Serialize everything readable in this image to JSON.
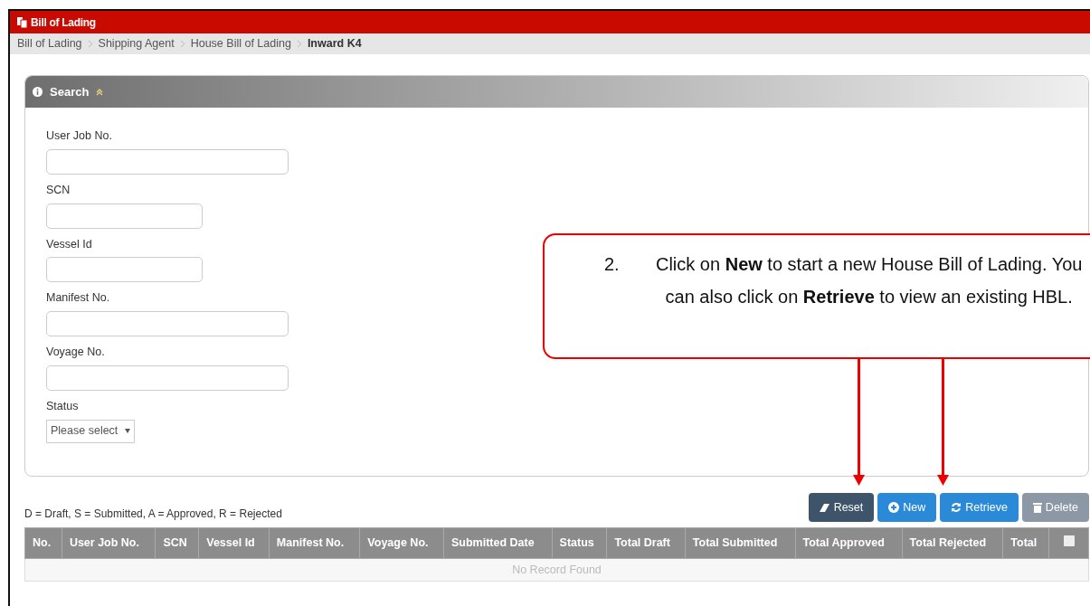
{
  "window": {
    "title": "Bill of Lading"
  },
  "breadcrumb": [
    {
      "label": "Bill of Lading",
      "current": false
    },
    {
      "label": "Shipping Agent",
      "current": false
    },
    {
      "label": "House Bill of Lading",
      "current": false
    },
    {
      "label": "Inward K4",
      "current": true
    }
  ],
  "search_panel": {
    "title": "Search",
    "expanded": true,
    "fields": [
      {
        "label": "User Job No.",
        "kind": "text"
      },
      {
        "label": "SCN",
        "kind": "text"
      },
      {
        "label": "Vessel Id",
        "kind": "text"
      },
      {
        "label": "Manifest No.",
        "kind": "text"
      },
      {
        "label": "Voyage No.",
        "kind": "text"
      },
      {
        "label": "Status",
        "kind": "select",
        "value": "Please select"
      }
    ]
  },
  "legend": "D = Draft, S = Submitted, A = Approved, R = Rejected",
  "buttons": [
    {
      "label": "Reset",
      "kind": "reset",
      "disabled": false
    },
    {
      "label": "New",
      "kind": "new",
      "disabled": false
    },
    {
      "label": "Retrieve",
      "kind": "retrieve",
      "disabled": false
    },
    {
      "label": "Delete",
      "kind": "delete",
      "disabled": true
    }
  ],
  "table": {
    "columns": [
      "No.",
      "User Job No.",
      "SCN",
      "Vessel Id",
      "Manifest No.",
      "Voyage No.",
      "Submitted Date",
      "Status",
      "Total Draft",
      "Total Submitted",
      "Total Approved",
      "Total Rejected",
      "Total"
    ],
    "select_all_checked": false,
    "empty_message": "No Record Found"
  },
  "callout": {
    "number": "2.",
    "text": "Click on **New** to start a new House Bill of Lading. You can also click on **Retrieve** to view an existing HBL."
  }
}
